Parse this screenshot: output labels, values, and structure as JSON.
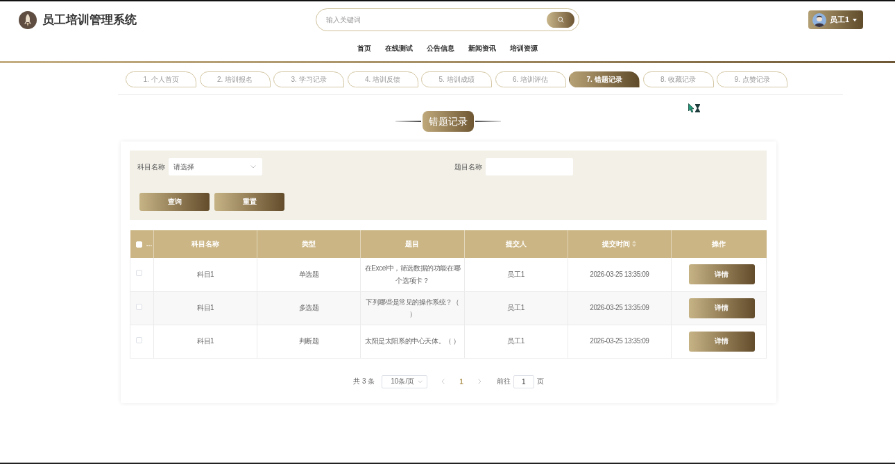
{
  "header": {
    "title": "员工培训管理系统",
    "search": {
      "placeholder": "输入关键词"
    },
    "user": {
      "name": "员工1"
    }
  },
  "nav": [
    {
      "label": "首页"
    },
    {
      "label": "在线测试"
    },
    {
      "label": "公告信息"
    },
    {
      "label": "新闻资讯"
    },
    {
      "label": "培训资源"
    }
  ],
  "tabs": [
    {
      "label": "1. 个人首页",
      "selected": false
    },
    {
      "label": "2. 培训报名",
      "selected": false
    },
    {
      "label": "3. 学习记录",
      "selected": false
    },
    {
      "label": "4. 培训反馈",
      "selected": false
    },
    {
      "label": "5. 培训成绩",
      "selected": false
    },
    {
      "label": "6. 培训评估",
      "selected": false
    },
    {
      "label": "7. 错题记录",
      "selected": true
    },
    {
      "label": "8. 收藏记录",
      "selected": false
    },
    {
      "label": "9. 点赞记录",
      "selected": false
    }
  ],
  "page_title": "错题记录",
  "filters": [
    {
      "kind": "select",
      "label": "科目名称",
      "placeholder": "请选择"
    },
    {
      "kind": "input",
      "label": "题目名称"
    }
  ],
  "filter_buttons": [
    "查询",
    "重置"
  ],
  "table": {
    "select_all": {
      "label": "…",
      "checked": false
    },
    "columns": [
      {
        "kind": "text",
        "label": "科目名称"
      },
      {
        "kind": "text",
        "label": "类型"
      },
      {
        "kind": "text",
        "label": "题目"
      },
      {
        "kind": "text",
        "label": "提交人"
      },
      {
        "kind": "text",
        "label": "提交时间",
        "sortable": true
      },
      {
        "kind": "action",
        "label": "操作"
      }
    ],
    "rows": [
      {
        "checked": false,
        "cells": [
          "科目1",
          "单选题",
          "在Excel中，筛选数据的功能在哪个选项卡？",
          "员工1",
          "2026-03-25 13:35:09",
          "详情"
        ]
      },
      {
        "checked": false,
        "cells": [
          "科目1",
          "多选题",
          "下列哪些是常见的操作系统？（）",
          "员工1",
          "2026-03-25 13:35:09",
          "详情"
        ]
      },
      {
        "checked": false,
        "cells": [
          "科目1",
          "判断题",
          "太阳是太阳系的中心天体。（ ）",
          "员工1",
          "2026-03-25 13:35:09",
          "详情"
        ]
      }
    ]
  },
  "pagination": {
    "total": "共 3 条",
    "page_size": "10条/页",
    "prev_disabled": true,
    "pages": [
      {
        "label": "1",
        "selected": true
      }
    ],
    "next_disabled": true,
    "goto_label": "前往",
    "goto_value": "1",
    "goto_suffix": "页"
  }
}
